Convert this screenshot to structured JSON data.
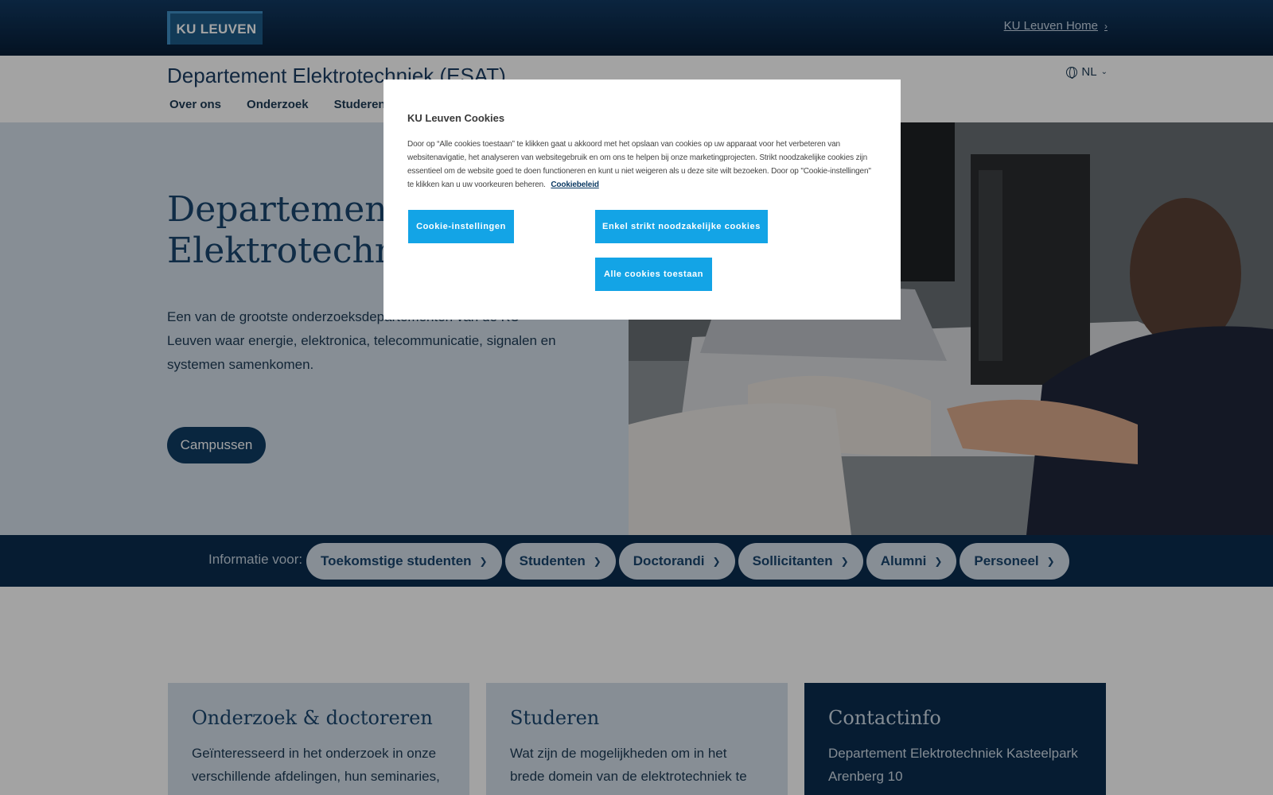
{
  "topbar": {
    "logo_text": "KU LEUVEN",
    "home_link": "KU Leuven Home"
  },
  "header": {
    "dept_title": "Departement Elektrotechniek (ESAT)",
    "language": "NL",
    "nav": [
      "Over ons",
      "Onderzoek",
      "Studeren"
    ]
  },
  "hero": {
    "title_line1": "Departement",
    "title_line2": "Elektrotechniek",
    "text": "Een van de grootste onderzoeksdepartementen van de KU Leuven waar energie, elektronica, telecommunicatie, signalen en systemen samenkomen.",
    "button": "Campussen"
  },
  "infobar": {
    "label": "Informatie voor:",
    "pills": [
      "Toekomstige studenten",
      "Studenten",
      "Doctorandi",
      "Sollicitanten",
      "Alumni",
      "Personeel"
    ]
  },
  "cards": [
    {
      "title": "Onderzoek & doctoreren",
      "text": "Geïnteresseerd in het onderzoek in onze verschillende afdelingen, hun seminaries,"
    },
    {
      "title": "Studeren",
      "text": "Wat zijn de mogelijkheden om in het brede domein van de elektrotechniek te"
    },
    {
      "title": "Contactinfo",
      "text": "Departement Elektrotechniek Kasteelpark Arenberg 10"
    }
  ],
  "cookie_modal": {
    "title": "KU Leuven Cookies",
    "body": "Door op “Alle cookies toestaan” te klikken gaat u akkoord met het opslaan van cookies op uw apparaat voor het verbeteren van websitenavigatie, het analyseren van websitegebruik en om ons te helpen bij onze marketingprojecten. Strikt noodzakelijke cookies zijn essentieel om de website goed te doen functioneren en kunt u niet weigeren als u deze site wilt bezoeken. Door op \"Cookie-instellingen\" te klikken kan u uw voorkeuren beheren.",
    "policy_link": "Cookiebeleid",
    "btn_settings": "Cookie-instellingen",
    "btn_necessary": "Enkel strikt noodzakelijke cookies",
    "btn_accept_all": "Alle cookies toestaan"
  }
}
